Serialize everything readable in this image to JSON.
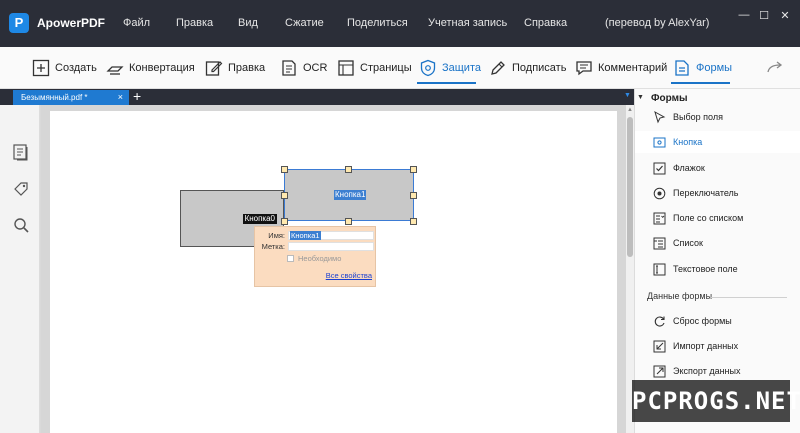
{
  "app": {
    "logo": "P",
    "name": "ApowerPDF"
  },
  "menu": [
    "Файл",
    "Правка",
    "Вид",
    "Сжатие",
    "Поделиться",
    "Учетная запись",
    "Справка",
    "(перевод by AlexYar)"
  ],
  "window_controls": {
    "minimize": "—",
    "maximize": "☐",
    "close": "✕"
  },
  "toolbar": {
    "items": [
      "Создать",
      "Конвертация",
      "Правка",
      "OCR",
      "Страницы",
      "Защита",
      "Подписать",
      "Комментарий",
      "Формы"
    ],
    "active": "Формы"
  },
  "tabs": {
    "doc_name": "Безымянный.pdf *",
    "close": "×",
    "add": "+",
    "caret": "▼"
  },
  "page": {
    "button0_label": "Кнопка0",
    "button1_label": "Кнопка1",
    "popup": {
      "name_label": "Имя:",
      "name_value": "Кнопка1",
      "tag_label": "Метка:",
      "tag_value": "",
      "required_label": "Необходимо",
      "all_props": "Все свойства"
    }
  },
  "right_panel": {
    "title": "Формы",
    "items": [
      {
        "label": "Выбор поля",
        "icon": "cursor-icon"
      },
      {
        "label": "Кнопка",
        "icon": "button-icon"
      },
      {
        "label": "Флажок",
        "icon": "checkbox-icon"
      },
      {
        "label": "Переключатель",
        "icon": "radio-icon"
      },
      {
        "label": "Поле со списком",
        "icon": "combobox-icon"
      },
      {
        "label": "Список",
        "icon": "listbox-icon"
      },
      {
        "label": "Текстовое поле",
        "icon": "textfield-icon"
      }
    ],
    "active_item": "Кнопка",
    "data_section_title": "Данные формы",
    "data_items": [
      {
        "label": "Сброс формы",
        "icon": "reset-icon"
      },
      {
        "label": "Импорт данных",
        "icon": "import-icon"
      },
      {
        "label": "Экспорт данных",
        "icon": "export-icon"
      }
    ]
  },
  "watermark": "PCPROGS.NET",
  "colors": {
    "accent": "#1a73c7",
    "titlebar": "#2b2e38",
    "tab_active": "#1f7ad1",
    "popup_bg": "#fbdcc0"
  }
}
